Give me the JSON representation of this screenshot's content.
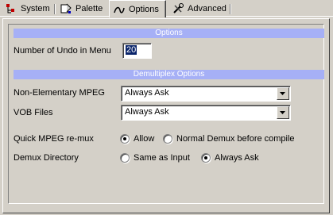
{
  "tabs": [
    {
      "label": "System",
      "icon": "system-tree-icon",
      "active": false
    },
    {
      "label": "Palette",
      "icon": "palette-paint-icon",
      "active": false
    },
    {
      "label": "Options",
      "icon": "options-curve-icon",
      "active": true
    },
    {
      "label": "Advanced",
      "icon": "advanced-tools-icon",
      "active": false
    }
  ],
  "options_section": {
    "title": "Options",
    "undo_label": "Number of Undo in Menu",
    "undo_value": "20"
  },
  "demux_section": {
    "title": "Demultiplex Options",
    "non_elementary_label": "Non-Elementary MPEG",
    "non_elementary_value": "Always Ask",
    "vob_label": "VOB Files",
    "vob_value": "Always Ask",
    "remux_label": "Quick MPEG re-mux",
    "remux_allow": "Allow",
    "remux_normal": "Normal Demux before compile",
    "remux_selected": "Allow",
    "dir_label": "Demux Directory",
    "dir_same": "Same as Input",
    "dir_ask": "Always Ask",
    "dir_selected": "Always Ask"
  },
  "colors": {
    "section_header_bg": "#a6b0f6",
    "window_bg": "#d4d0c8",
    "selection_bg": "#0a246a"
  }
}
